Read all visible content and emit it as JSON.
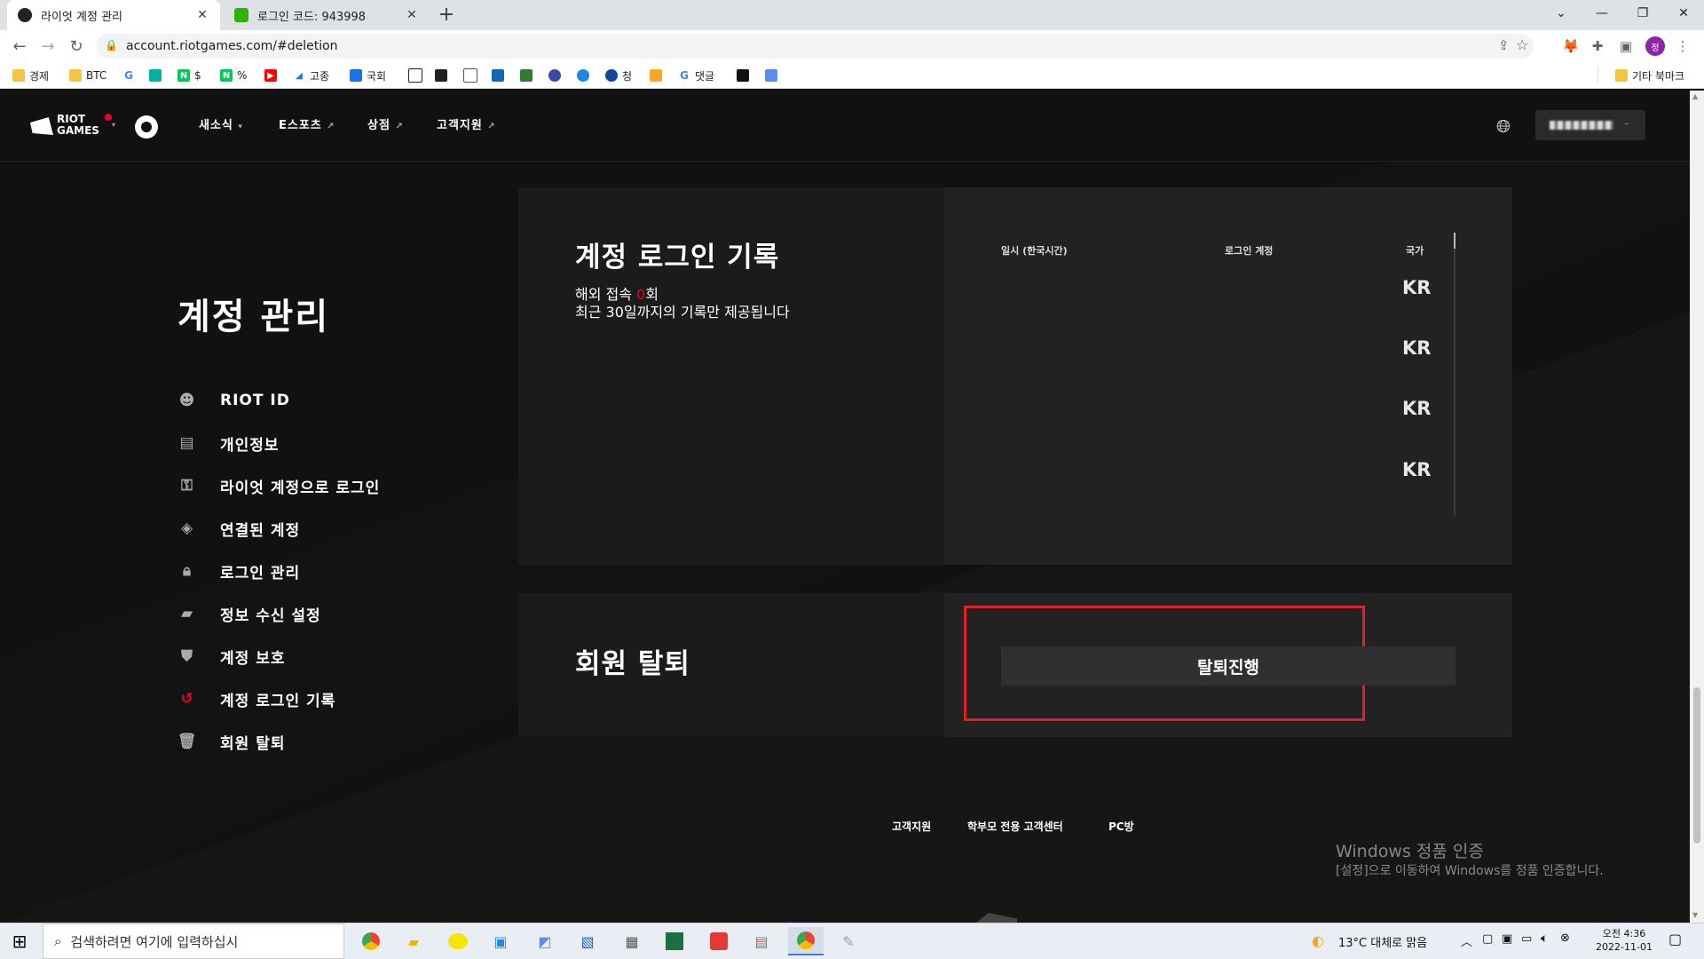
{
  "browser": {
    "tabs": [
      {
        "title": "라이엇 계정 관리",
        "active": true
      },
      {
        "title": "로그인 코드: 943998",
        "active": false
      }
    ],
    "new_tab": "+",
    "url": "account.riotgames.com/#deletion",
    "bookmarks": [
      "경제",
      "BTC",
      "$",
      "%",
      "고종",
      "국회",
      "청",
      "댓글"
    ],
    "other_bookmarks": "기타 북마크",
    "profile_initial": "정"
  },
  "site_nav": {
    "logo_top": "RIOT",
    "logo_bottom": "GAMES",
    "links": [
      "새소식",
      "E스포츠",
      "상점",
      "고객지원"
    ]
  },
  "page": {
    "title": "계정 관리",
    "sidebar": [
      {
        "label": "RIOT ID",
        "icon": "riot-id-icon",
        "active": false
      },
      {
        "label": "개인정보",
        "icon": "id-card-icon",
        "active": false
      },
      {
        "label": "라이엇 계정으로 로그인",
        "icon": "key-icon",
        "active": false
      },
      {
        "label": "연결된 계정",
        "icon": "layers-icon",
        "active": false
      },
      {
        "label": "로그인 관리",
        "icon": "lock-icon",
        "active": false
      },
      {
        "label": "정보 수신 설정",
        "icon": "chat-icon",
        "active": false
      },
      {
        "label": "계정 보호",
        "icon": "shield-icon",
        "active": false
      },
      {
        "label": "계정 로그인 기록",
        "icon": "history-icon",
        "active": true
      },
      {
        "label": "회원 탈퇴",
        "icon": "trash-icon",
        "active": false
      }
    ],
    "login_history": {
      "title": "계정 로그인 기록",
      "overseas_prefix": "해외 접속 ",
      "overseas_count": "0",
      "overseas_suffix": "회",
      "note": "최근 30일까지의 기록만 제공됩니다",
      "columns": [
        "일시 (한국시간)",
        "로그인 계정",
        "국가"
      ],
      "rows": [
        {
          "country": "KR"
        },
        {
          "country": "KR"
        },
        {
          "country": "KR"
        },
        {
          "country": "KR"
        }
      ]
    },
    "deletion": {
      "title": "회원 탈퇴",
      "button": "탈퇴진행"
    },
    "footer_links": [
      "고객지원",
      "학부모 전용 고객센터",
      "PC방"
    ],
    "activation": {
      "line1": "Windows 정품 인증",
      "line2": "[설정]으로 이동하여 Windows를 정품 인증합니다."
    }
  },
  "taskbar": {
    "search_placeholder": "검색하려면 여기에 입력하십시",
    "weather": "13°C  대체로 맑음",
    "time": "오전 4:36",
    "date": "2022-11-01"
  },
  "colors": {
    "accent_red": "#eb0029",
    "highlight_box": "#e01f26",
    "page_bg": "#111111"
  }
}
